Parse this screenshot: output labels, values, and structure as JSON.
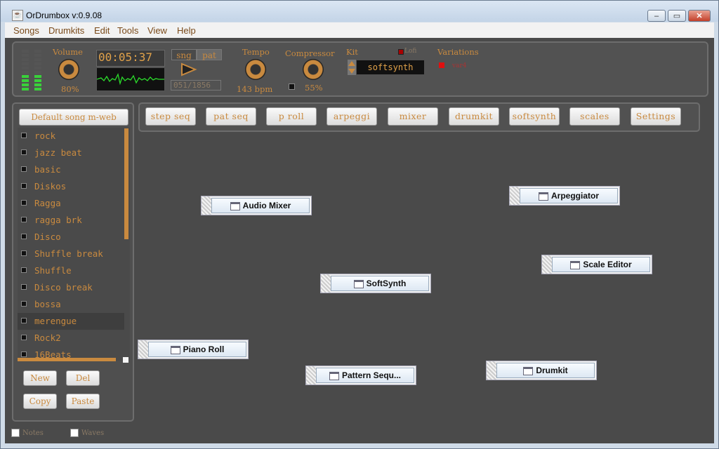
{
  "window": {
    "title": "OrDrumbox v:0.9.08"
  },
  "menu": [
    "Songs",
    "Drumkits",
    "Edit",
    "Tools",
    "View",
    "Help"
  ],
  "controls": {
    "volume_label": "Volume",
    "volume_value": "80%",
    "time": "00:05:37",
    "mode_song": "sng",
    "mode_pattern": "pat",
    "position": "051/1856",
    "tempo_label": "Tempo",
    "tempo_value": "143 bpm",
    "compressor_label": "Compressor",
    "compressor_value": "55%",
    "kit_label": "Kit",
    "lofi_label": "Lofi",
    "kit_value": "softsynth",
    "variations_label": "Variations",
    "variation_value": "var4"
  },
  "tabs": [
    "step seq",
    "pat seq",
    "p roll",
    "arpeggi",
    "mixer",
    "drumkit",
    "softsynth",
    "scales",
    "Settings"
  ],
  "song_panel": {
    "default_button": "Default song m-web",
    "songs": [
      "rock",
      "jazz beat",
      "basic",
      "Diskos",
      "Ragga",
      "ragga brk",
      "Disco",
      "Shuffle break",
      "Shuffle",
      "Disco break",
      "bossa",
      "merengue",
      "Rock2",
      "16Beats"
    ],
    "selected_index": 11,
    "buttons": {
      "new": "New",
      "del": "Del",
      "copy": "Copy",
      "paste": "Paste"
    }
  },
  "internal_frames": [
    "Audio Mixer",
    "Arpeggiator",
    "Scale Editor",
    "SoftSynth",
    "Piano Roll",
    "Pattern Sequ...",
    "Drumkit"
  ],
  "status": {
    "notes": "Notes",
    "waves": "Waves"
  },
  "colors": {
    "accent": "#c98a3f",
    "meter_green": "#39d13a",
    "waveform": "#2bdc2b",
    "indicator_red": "#e01010"
  }
}
